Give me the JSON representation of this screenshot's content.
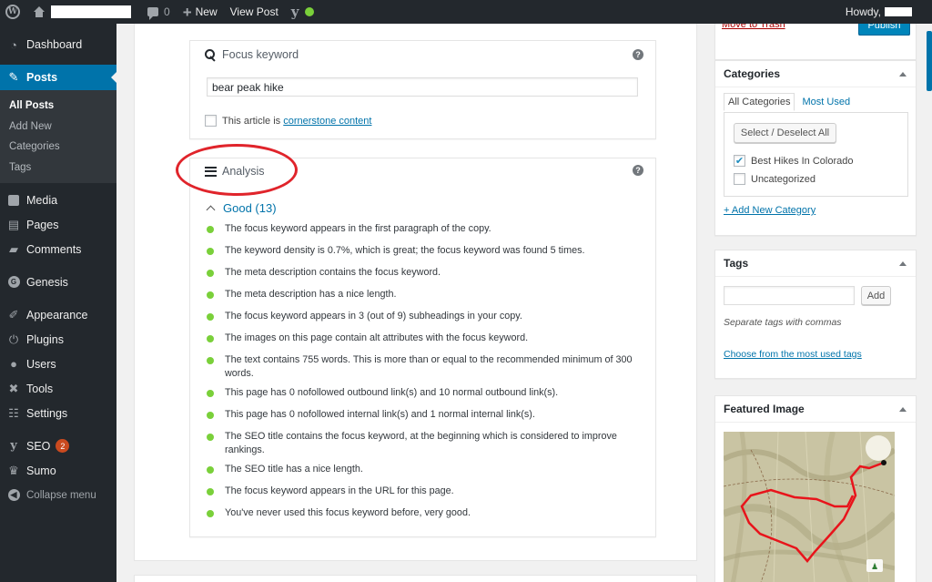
{
  "adminbar": {
    "comments_count": "0",
    "new_label": "New",
    "view_post_label": "View Post",
    "howdy_label": "Howdy,"
  },
  "sidebar": {
    "items": [
      {
        "label": "Dashboard",
        "icon": "dashboard-icon"
      },
      {
        "label": "Posts",
        "icon": "pin-icon",
        "current": true
      },
      {
        "label": "Media",
        "icon": "media-icon"
      },
      {
        "label": "Pages",
        "icon": "pages-icon"
      },
      {
        "label": "Comments",
        "icon": "comment-icon"
      },
      {
        "label": "Genesis",
        "icon": "genesis-icon"
      },
      {
        "label": "Appearance",
        "icon": "brush-icon"
      },
      {
        "label": "Plugins",
        "icon": "plugin-icon"
      },
      {
        "label": "Users",
        "icon": "users-icon"
      },
      {
        "label": "Tools",
        "icon": "wrench-icon"
      },
      {
        "label": "Settings",
        "icon": "settings-icon"
      },
      {
        "label": "SEO",
        "icon": "yoast-icon",
        "badge": "2"
      },
      {
        "label": "Sumo",
        "icon": "crown-icon"
      },
      {
        "label": "Collapse menu",
        "icon": "collapse-icon"
      }
    ],
    "posts_submenu": [
      "All Posts",
      "Add New",
      "Categories",
      "Tags"
    ]
  },
  "focus": {
    "title": "Focus keyword",
    "value": "bear peak hike",
    "cornerstone_prefix": "This article is",
    "cornerstone_link": "cornerstone content"
  },
  "analysis": {
    "title": "Analysis",
    "good_label": "Good (13)",
    "results": [
      "The focus keyword appears in the first paragraph of the copy.",
      "The keyword density is 0.7%, which is great; the focus keyword was found 5 times.",
      "The meta description contains the focus keyword.",
      "The meta description has a nice length.",
      "The focus keyword appears in 3 (out of 9) subheadings in your copy.",
      "The images on this page contain alt attributes with the focus keyword.",
      "The text contains 755 words. This is more than or equal to the recommended minimum of 300 words.",
      "This page has 0 nofollowed outbound link(s) and 10 normal outbound link(s).",
      "This page has 0 nofollowed internal link(s) and 1 normal internal link(s).",
      "The SEO title contains the focus keyword, at the beginning which is considered to improve rankings.",
      "The SEO title has a nice length.",
      "The focus keyword appears in the URL for this page.",
      "You've never used this focus keyword before, very good."
    ]
  },
  "publish": {
    "trash_label": "Move to Trash",
    "publish_label": "Publish"
  },
  "categories": {
    "title": "Categories",
    "tab_all": "All Categories",
    "tab_most_used": "Most Used",
    "select_all_label": "Select / Deselect All",
    "items": [
      {
        "label": "Best Hikes In Colorado",
        "checked": true
      },
      {
        "label": "Uncategorized",
        "checked": false
      }
    ],
    "add_new_label": "+ Add New Category"
  },
  "tags": {
    "title": "Tags",
    "add_label": "Add",
    "hint": "Separate tags with commas",
    "choose_link": "Choose from the most used tags"
  },
  "featured_image": {
    "title": "Featured Image"
  },
  "colors": {
    "admin_dark": "#23282d",
    "accent_blue": "#0073aa",
    "good_green": "#7ad03a",
    "annotation_red": "#e0242b",
    "trail_red": "#e8141b"
  }
}
